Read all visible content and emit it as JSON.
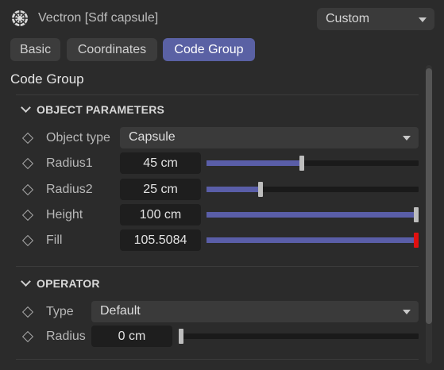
{
  "title": "Vectron [Sdf capsule]",
  "preset": {
    "value": "Custom"
  },
  "tabs": [
    {
      "label": "Basic",
      "active": false
    },
    {
      "label": "Coordinates",
      "active": false
    },
    {
      "label": "Code Group",
      "active": true
    }
  ],
  "panel_title": "Code Group",
  "object_parameters": {
    "title": "OBJECT PARAMETERS",
    "object_type": {
      "label": "Object type",
      "value": "Capsule"
    },
    "params": [
      {
        "label": "Radius1",
        "value": "45 cm",
        "slider_fraction": 0.45,
        "over_limit": false
      },
      {
        "label": "Radius2",
        "value": "25 cm",
        "slider_fraction": 0.25,
        "over_limit": false
      },
      {
        "label": "Height",
        "value": "100 cm",
        "slider_fraction": 1.0,
        "over_limit": false
      },
      {
        "label": "Fill",
        "value": "105.5084",
        "slider_fraction": 1.0,
        "over_limit": true
      }
    ]
  },
  "operator": {
    "title": "OPERATOR",
    "type": {
      "label": "Type",
      "value": "Default"
    },
    "radius": {
      "label": "Radius",
      "value": "0 cm",
      "slider_fraction": 0.0
    }
  },
  "colors": {
    "accent": "#5a61a4",
    "slider_fill": "#5a5ea8",
    "over_limit": "#e01010",
    "background": "#2b2b2b"
  }
}
